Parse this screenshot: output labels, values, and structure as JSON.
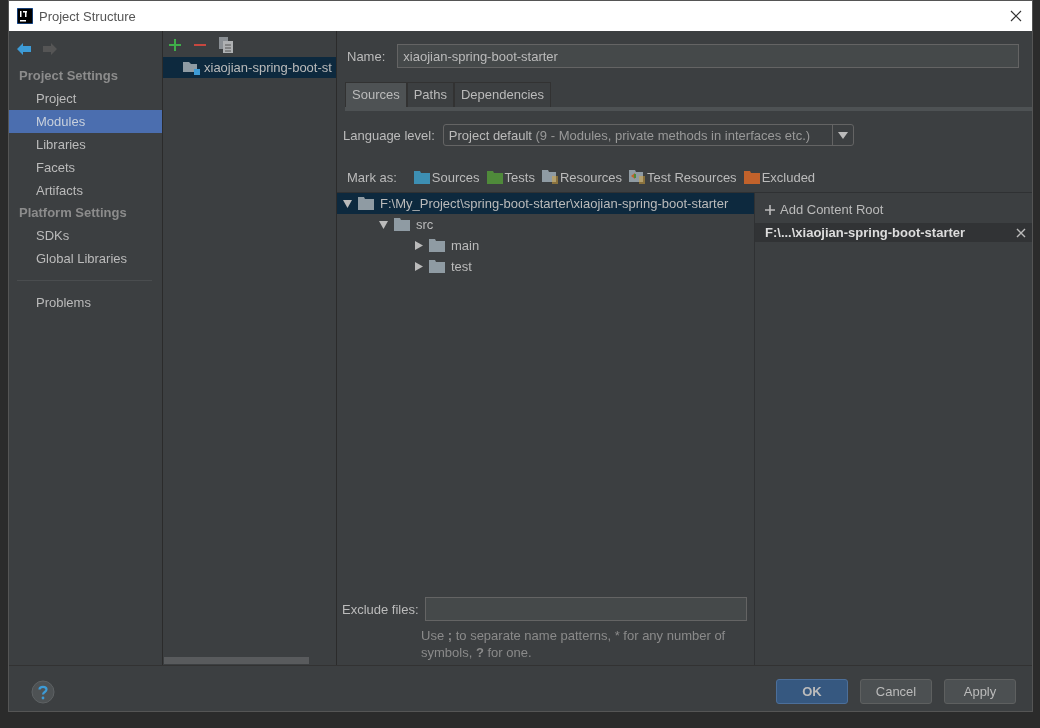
{
  "window": {
    "title": "Project Structure"
  },
  "sidebar": [
    {
      "kind": "header",
      "label": "Project Settings"
    },
    {
      "kind": "item",
      "label": "Project",
      "selected": false
    },
    {
      "kind": "item",
      "label": "Modules",
      "selected": true
    },
    {
      "kind": "item",
      "label": "Libraries",
      "selected": false
    },
    {
      "kind": "item",
      "label": "Facets",
      "selected": false
    },
    {
      "kind": "item",
      "label": "Artifacts",
      "selected": false
    },
    {
      "kind": "header",
      "label": "Platform Settings"
    },
    {
      "kind": "item",
      "label": "SDKs",
      "selected": false
    },
    {
      "kind": "item",
      "label": "Global Libraries",
      "selected": false
    },
    {
      "kind": "separator"
    },
    {
      "kind": "item",
      "label": "Problems",
      "selected": false
    }
  ],
  "modules": [
    {
      "label": "xiaojian-spring-boot-st",
      "selected": true
    }
  ],
  "name_field": {
    "label": "Name:",
    "value": "xiaojian-spring-boot-starter"
  },
  "tabs": [
    {
      "label": "Sources",
      "selected": true
    },
    {
      "label": "Paths",
      "selected": false
    },
    {
      "label": "Dependencies",
      "selected": false
    }
  ],
  "language_level": {
    "label": "Language level:",
    "value": "Project default",
    "detail": "(9 - Modules, private methods in interfaces etc.)"
  },
  "mark_as": {
    "label": "Mark as:",
    "items": [
      {
        "kind": "folder",
        "label": "Sources",
        "color": "#3d8fb3"
      },
      {
        "kind": "folder",
        "label": "Tests",
        "color": "#4f8a3a"
      },
      {
        "kind": "resource",
        "label": "Resources",
        "color": "#8f9ba3"
      },
      {
        "kind": "test-resource",
        "label": "Test Resources",
        "color": "#8f9ba3"
      },
      {
        "kind": "folder",
        "label": "Excluded",
        "color": "#c2622b"
      }
    ]
  },
  "tree": [
    {
      "label": "F:\\My_Project\\spring-boot-starter\\xiaojian-spring-boot-starter",
      "expanded": true,
      "selected": true,
      "children": [
        {
          "label": "src",
          "expanded": true,
          "selected": false,
          "children": [
            {
              "label": "main",
              "expanded": false,
              "selected": false
            },
            {
              "label": "test",
              "expanded": false,
              "selected": false
            }
          ]
        }
      ]
    }
  ],
  "content_roots": {
    "add_label": "Add Content Root",
    "roots": [
      {
        "label": "F:\\...\\xiaojian-spring-boot-starter",
        "selected": true
      }
    ]
  },
  "exclude_files": {
    "label": "Exclude files:",
    "hint": [
      {
        "text": "Use ",
        "bold": false
      },
      {
        "text": ";",
        "bold": true
      },
      {
        "text": " to separate name patterns, * for any number of symbols, ",
        "bold": false
      },
      {
        "text": "?",
        "bold": true
      },
      {
        "text": " for one.",
        "bold": false
      }
    ]
  },
  "buttons": [
    {
      "label": "OK",
      "kind": "primary"
    },
    {
      "label": "Cancel",
      "kind": "normal"
    },
    {
      "label": "Apply",
      "kind": "normal"
    }
  ]
}
